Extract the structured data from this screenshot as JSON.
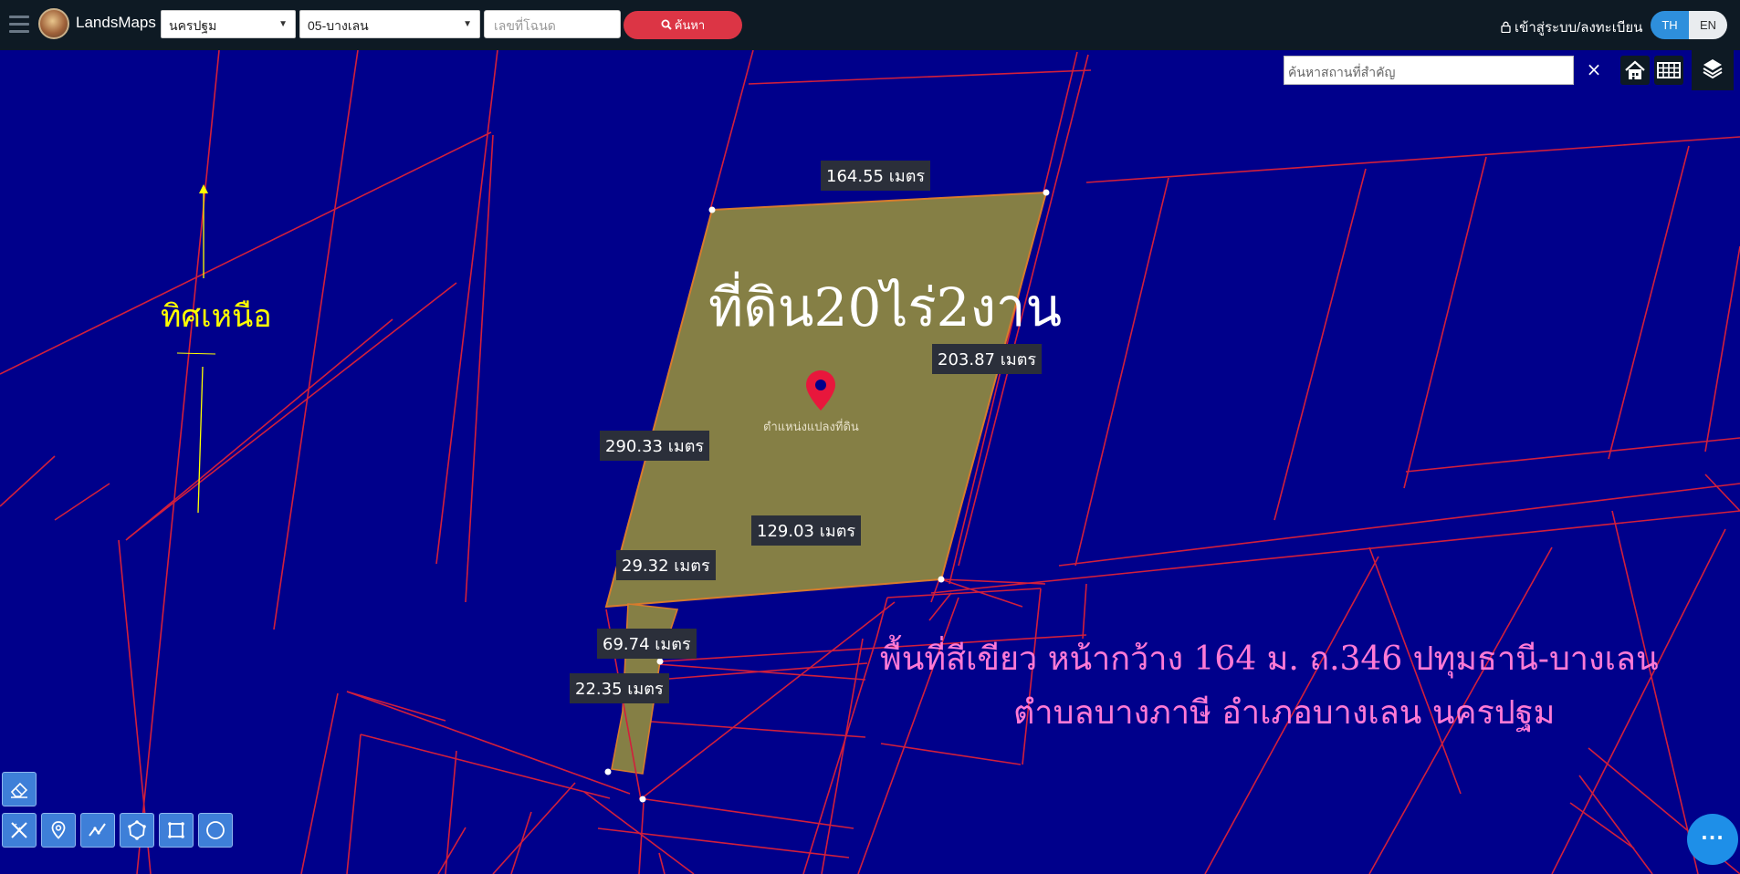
{
  "topbar": {
    "brand": "LandsMaps",
    "province": "นครปฐม",
    "district": "05-บางเลน",
    "deed_placeholder": "เลขที่โฉนด",
    "search_label": "ค้นหา",
    "login_label": "เข้าสู่ระบบ/ลงทะเบียน",
    "lang_th": "TH",
    "lang_en": "EN"
  },
  "map": {
    "search_placeholder": "ค้นหาสถานที่สำคัญ",
    "clear": "×",
    "north_label": "ทิศเหนือ",
    "parcel_title": "ที่ดิน20ไร่2งาน",
    "marker_label": "ตำแหน่งแปลงที่ดิน",
    "measurements": {
      "top": "164.55 เมตร",
      "right": "203.87 เมตร",
      "left": "290.33 เมตร",
      "bottom": "129.03 เมตร",
      "seg1": "29.32 เมตร",
      "seg2": "69.74 เมตร",
      "seg3": "22.35 เมตร"
    },
    "caption_line1": "พื้นที่สีเขียว หน้ากว้าง 164 ม. ถ.346 ปทุมธานี-บางเลน",
    "caption_line2": "ตำบลบางภาษี อำเภอบางเลน นครปฐม"
  },
  "chat_dots": "···",
  "colors": {
    "map_bg": "#00008b",
    "parcel_lines": "#d21f3c",
    "parcel_fill": "#857f45",
    "north": "#ffff00",
    "caption": "#ff7ad6",
    "search_button": "#dc3545",
    "lang_active": "#2e8fdc"
  }
}
